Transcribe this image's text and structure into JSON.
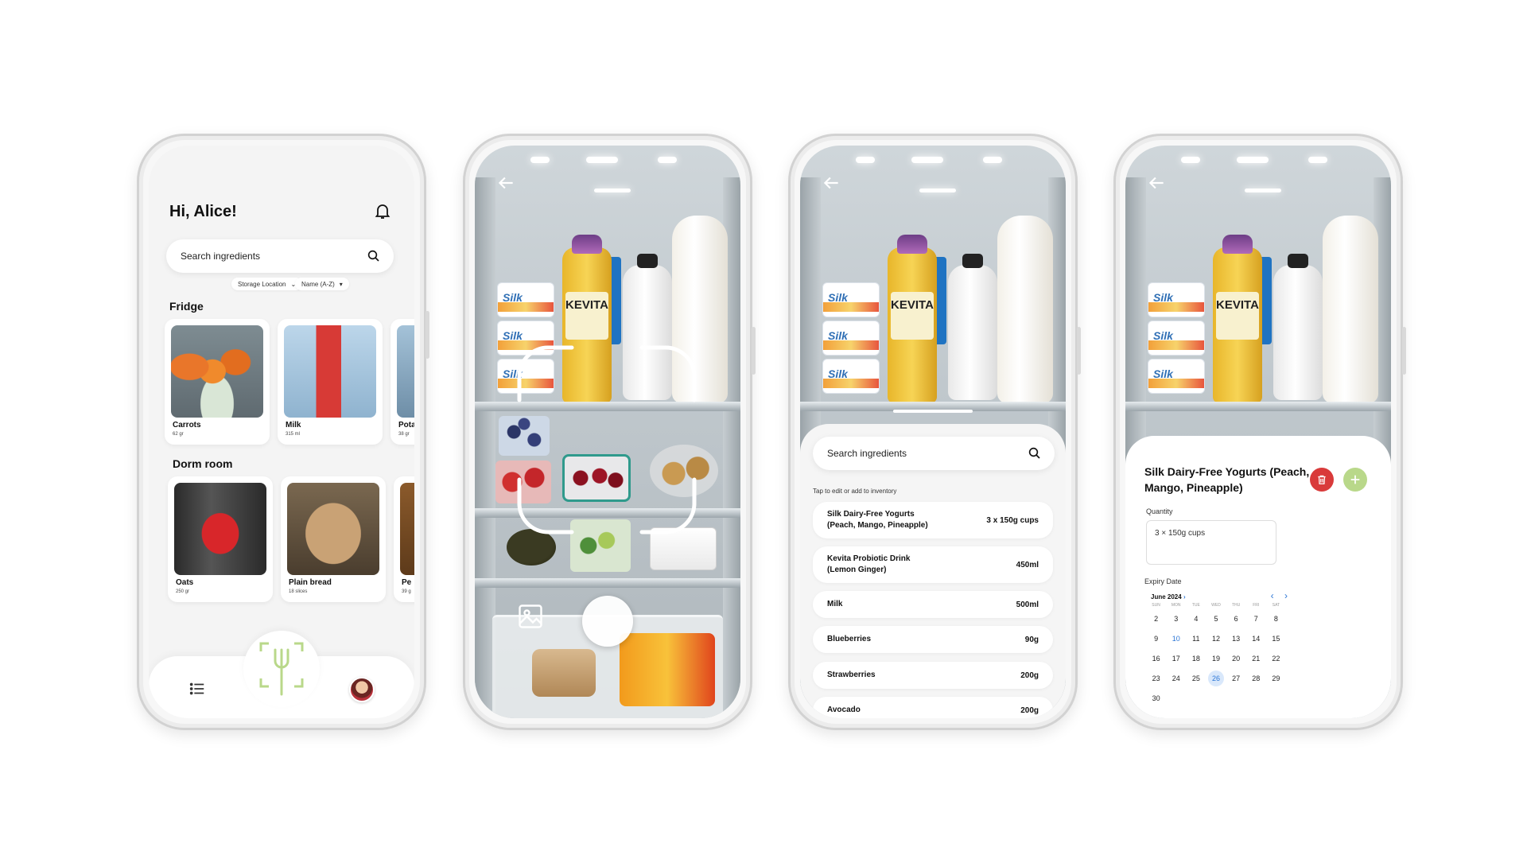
{
  "phone1": {
    "greeting": "Hi, Alice!",
    "search_placeholder": "Search ingredients",
    "filters": {
      "storage": "Storage Location",
      "sort": "Name (A-Z)"
    },
    "sections": [
      {
        "title": "Fridge",
        "items": [
          {
            "name": "Carrots",
            "qty": "62 gr"
          },
          {
            "name": "Milk",
            "qty": "315 ml"
          },
          {
            "name": "Pota",
            "qty": "38 gr"
          }
        ]
      },
      {
        "title": "Dorm room",
        "items": [
          {
            "name": "Oats",
            "qty": "250 gr"
          },
          {
            "name": "Plain bread",
            "qty": "18 slices"
          },
          {
            "name": "Pe",
            "qty": "39 g"
          }
        ]
      }
    ]
  },
  "phone2": {
    "photo_text": {
      "brand": "KEVITA",
      "yogurt": "Silk"
    }
  },
  "phone3": {
    "search_placeholder": "Search ingredients",
    "hint": "Tap to edit or add to inventory",
    "rows": [
      {
        "name_line1": "Silk Dairy-Free Yogurts",
        "name_line2": "(Peach, Mango, Pineapple)",
        "qty": "3 x 150g cups"
      },
      {
        "name_line1": "Kevita Probiotic Drink",
        "name_line2": "(Lemon Ginger)",
        "qty": "450ml"
      },
      {
        "name_line1": "Milk",
        "name_line2": "",
        "qty": "500ml"
      },
      {
        "name_line1": "Blueberries",
        "name_line2": "",
        "qty": "90g"
      },
      {
        "name_line1": "Strawberries",
        "name_line2": "",
        "qty": "200g"
      },
      {
        "name_line1": "Avocado",
        "name_line2": "",
        "qty": "200g"
      }
    ]
  },
  "phone4": {
    "title": "Silk Dairy-Free Yogurts (Peach, Mango, Pineapple)",
    "quantity_label": "Quantity",
    "quantity_value": "3 × 150g cups",
    "expiry_label": "Expiry Date",
    "month": "June 2024",
    "weekdays": [
      "SUN",
      "MON",
      "TUE",
      "WED",
      "THU",
      "FRI",
      "SAT"
    ],
    "days": [
      "2",
      "3",
      "4",
      "5",
      "6",
      "7",
      "8",
      "9",
      "10",
      "11",
      "12",
      "13",
      "14",
      "15",
      "16",
      "17",
      "18",
      "19",
      "20",
      "21",
      "22",
      "23",
      "24",
      "25",
      "26",
      "27",
      "28",
      "29",
      "30"
    ],
    "today": "10",
    "selected": "26"
  },
  "colors": {
    "accent_green": "#b9d88a",
    "delete_red": "#d93a3a",
    "calendar_blue": "#2d77d6"
  }
}
